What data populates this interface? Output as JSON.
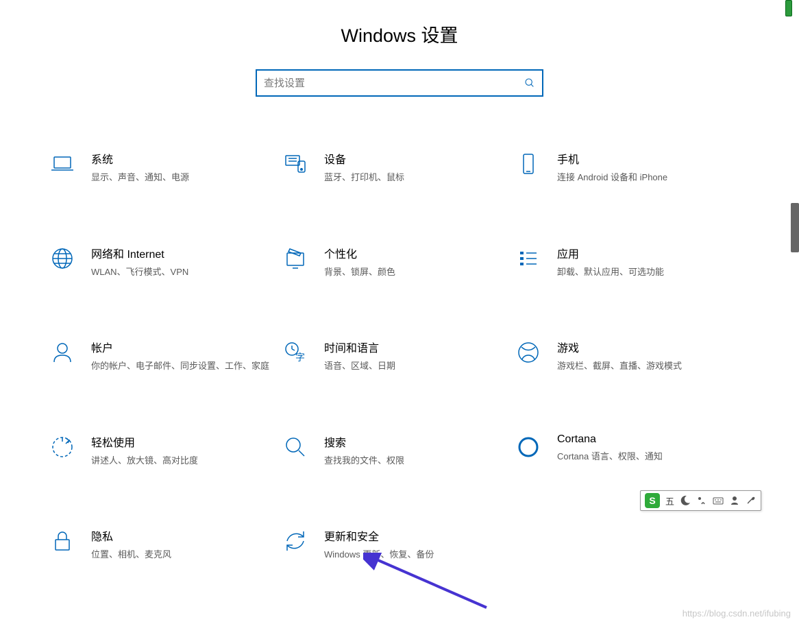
{
  "header": {
    "title": "Windows 设置"
  },
  "search": {
    "placeholder": "查找设置"
  },
  "tiles": [
    {
      "id": "system",
      "title": "系统",
      "desc": "显示、声音、通知、电源"
    },
    {
      "id": "devices",
      "title": "设备",
      "desc": "蓝牙、打印机、鼠标"
    },
    {
      "id": "phone",
      "title": "手机",
      "desc": "连接 Android 设备和 iPhone"
    },
    {
      "id": "network",
      "title": "网络和 Internet",
      "desc": "WLAN、飞行模式、VPN"
    },
    {
      "id": "personalization",
      "title": "个性化",
      "desc": "背景、锁屏、颜色"
    },
    {
      "id": "apps",
      "title": "应用",
      "desc": "卸载、默认应用、可选功能"
    },
    {
      "id": "accounts",
      "title": "帐户",
      "desc": "你的帐户、电子邮件、同步设置、工作、家庭"
    },
    {
      "id": "time-language",
      "title": "时间和语言",
      "desc": "语音、区域、日期"
    },
    {
      "id": "gaming",
      "title": "游戏",
      "desc": "游戏栏、截屏、直播、游戏模式"
    },
    {
      "id": "ease-of-access",
      "title": "轻松使用",
      "desc": "讲述人、放大镜、高对比度"
    },
    {
      "id": "search-cat",
      "title": "搜索",
      "desc": "查找我的文件、权限"
    },
    {
      "id": "cortana",
      "title": "Cortana",
      "desc": "Cortana 语言、权限、通知"
    },
    {
      "id": "privacy",
      "title": "隐私",
      "desc": "位置、相机、麦克风"
    },
    {
      "id": "update-security",
      "title": "更新和安全",
      "desc": "Windows 更新、恢复、备份"
    }
  ],
  "ime": {
    "logo": "S",
    "label": "五"
  },
  "watermark": "https://blog.csdn.net/ifubing",
  "colors": {
    "accent": "#0067b8",
    "arrow": "#4633d1"
  }
}
